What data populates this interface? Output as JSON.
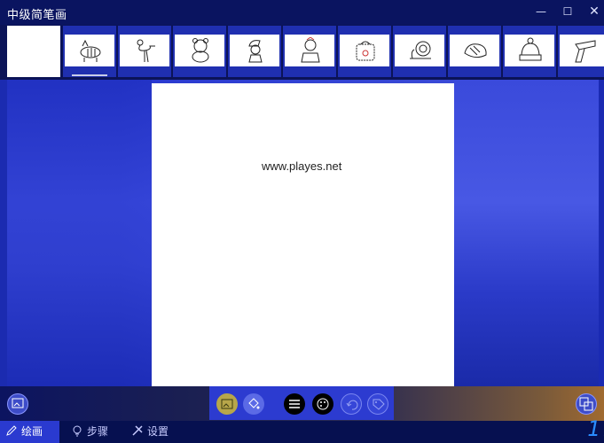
{
  "window": {
    "title": "中级简笔画",
    "minimize_glyph": "—",
    "maximize_glyph": "☐",
    "close_glyph": "✕"
  },
  "thumbnails": [
    {
      "name": "blank-page",
      "icon": "blank"
    },
    {
      "name": "zebra",
      "icon": "zebra-icon"
    },
    {
      "name": "flamingo",
      "icon": "flamingo-icon"
    },
    {
      "name": "bear",
      "icon": "bear-icon"
    },
    {
      "name": "smurf",
      "icon": "smurf-icon"
    },
    {
      "name": "girl",
      "icon": "girl-icon"
    },
    {
      "name": "bag",
      "icon": "bag-icon"
    },
    {
      "name": "snail",
      "icon": "snail-icon"
    },
    {
      "name": "shoe",
      "icon": "shoe-icon"
    },
    {
      "name": "hat",
      "icon": "hat-icon"
    },
    {
      "name": "scarf",
      "icon": "scarf-icon"
    }
  ],
  "canvas": {
    "watermark": "www.playes.net"
  },
  "toolbar": {
    "left_button": "gallery-icon",
    "right_button": "copy-icon",
    "tools": [
      "image-icon",
      "fill-icon",
      "menu-icon",
      "palette-icon",
      "undo-icon",
      "tag-icon"
    ]
  },
  "nav": {
    "draw": "绘画",
    "steps": "步骤",
    "settings": "设置"
  },
  "clock": {
    "partial": "1!"
  }
}
